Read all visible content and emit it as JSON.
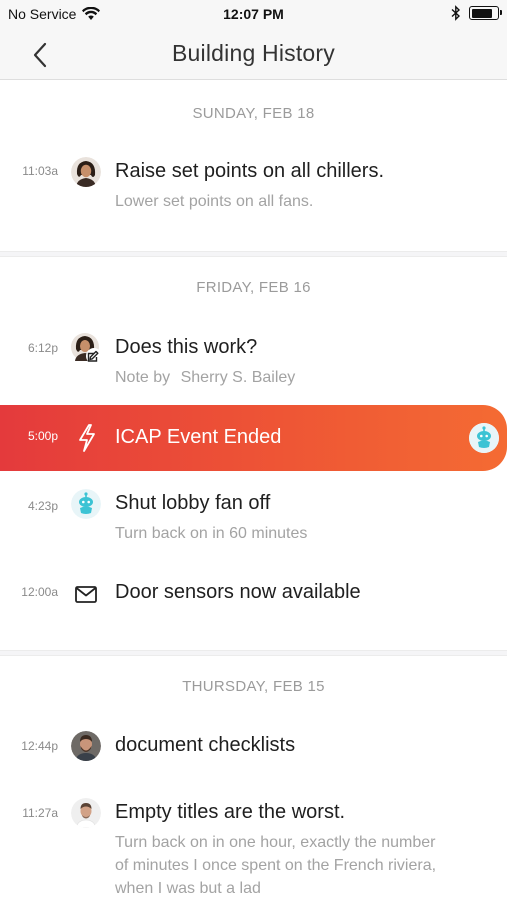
{
  "status_bar": {
    "carrier": "No Service",
    "time": "12:07 PM",
    "battery_level": 0.8
  },
  "nav": {
    "title": "Building History"
  },
  "colors": {
    "event_gradient_start": "#e43a3c",
    "event_gradient_end": "#f46b33",
    "robot_teal": "#3cc3d4",
    "subtext_gray": "#a3a3a3"
  },
  "sections": [
    {
      "date": "SUNDAY, FEB 18",
      "entries": [
        {
          "time": "11:03a",
          "icon": "avatar-woman-icon",
          "title": "Raise set points on all chillers.",
          "subtitle": "Lower set points on all fans."
        }
      ]
    },
    {
      "date": "FRIDAY, FEB 16",
      "entries": [
        {
          "time": "6:12p",
          "icon": "avatar-woman-note-icon",
          "title": "Does this work?",
          "note_prefix": "Note by",
          "note_author": "Sherry S. Bailey"
        },
        {
          "time": "5:00p",
          "icon": "lightning-bolt-icon",
          "title": "ICAP Event Ended",
          "highlight": true,
          "trailing_icon": "robot-icon"
        },
        {
          "time": "4:23p",
          "icon": "robot-icon",
          "title": "Shut lobby fan off",
          "subtitle": "Turn back on in 60 minutes"
        },
        {
          "time": "12:00a",
          "icon": "envelope-icon",
          "title": "Door sensors now available"
        }
      ]
    },
    {
      "date": "THURSDAY, FEB 15",
      "entries": [
        {
          "time": "12:44p",
          "icon": "avatar-man-beard-icon",
          "title": "document checklists"
        },
        {
          "time": "11:27a",
          "icon": "avatar-man-icon",
          "title": "Empty titles are the worst.",
          "subtitle_lines": [
            "Turn back on in one hour, exactly the number",
            "of minutes I once spent on the French riviera,",
            "when I was but a lad"
          ]
        }
      ]
    }
  ]
}
